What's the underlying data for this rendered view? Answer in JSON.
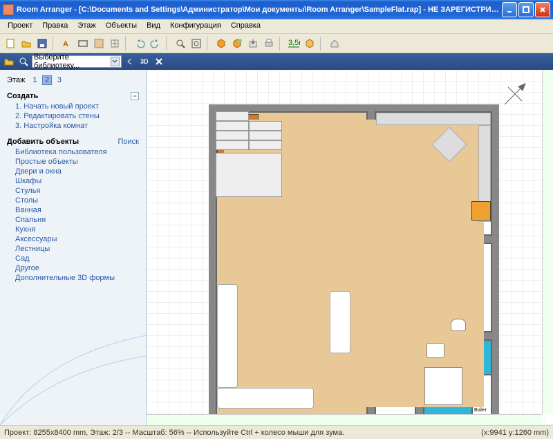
{
  "window": {
    "title": "Room Arranger - [C:\\Documents and Settings\\Администратор\\Мои документы\\Room Arranger\\SampleFlat.rap] - НЕ ЗАРЕГИСТРИРО..."
  },
  "menu": {
    "project": "Проект",
    "edit": "Правка",
    "floor": "Этаж",
    "objects": "Объекты",
    "view": "Вид",
    "config": "Конфигурация",
    "help": "Справка"
  },
  "toolbar2": {
    "lib_placeholder": "Выберите библиотеку...",
    "threeD": "3D"
  },
  "sidebar": {
    "floor_label": "Этаж",
    "floors": [
      "1",
      "2",
      "3"
    ],
    "create_head": "Создать",
    "create": [
      "1. Начать новый проект",
      "2. Редактировать стены",
      "3. Настройка комнат"
    ],
    "add_head": "Добавить объекты",
    "search": "Поиск",
    "add": [
      "Библиотека пользователя",
      "Простые объекты",
      "Двери и окна",
      "Шкафы",
      "Стулья",
      "Столы",
      "Ванная",
      "Спальня",
      "Кухня",
      "Аксессуары",
      "Лестницы",
      "Сад",
      "Другое",
      "Дополнительные 3D формы"
    ]
  },
  "closet_label": "Boiler",
  "status": {
    "left": "Проект: 8255x8400 mm, Этаж: 2/3 -- Масштаб: 56% -- Используйте Ctrl + колесо мыши для зума.",
    "right": "(x:9941 y:1260 mm)"
  }
}
